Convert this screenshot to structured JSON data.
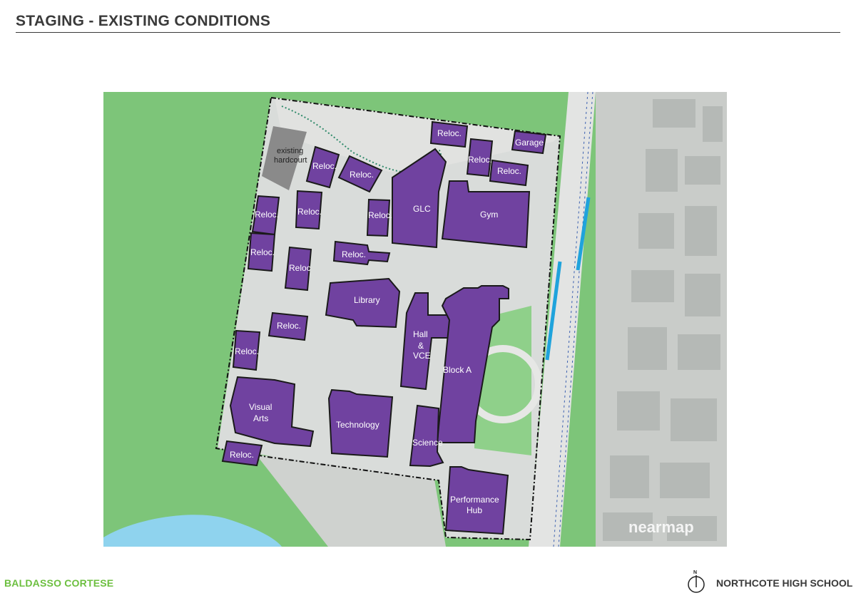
{
  "header": {
    "title": "STAGING - EXISTING CONDITIONS"
  },
  "map": {
    "watermark": "nearmap",
    "hardcourt_label": [
      "existing",
      "hardcourt"
    ],
    "buildings": {
      "reloc_top_right": "Reloc.",
      "garage": "Garage",
      "reloc_hc_1": "Reloc.",
      "reloc_hc_2": "Reloc.",
      "reloc_right_1": "Reloc.",
      "reloc_right_2": "Reloc.",
      "glc": "GLC",
      "gym": "Gym",
      "reloc_w1": "Reloc.",
      "reloc_w2": "Reloc.",
      "reloc_mid": "Reloc.",
      "reloc_w3": "Reloc.",
      "reloc_w4": "Reloc",
      "reloc_center": "Reloc.",
      "library": "Library",
      "reloc_sw1": "Reloc.",
      "reloc_sw2": "Reloc.",
      "hall": [
        "Hall",
        "&",
        "VCE"
      ],
      "block_a": "Block A",
      "visual_arts": [
        "Visual",
        "Arts"
      ],
      "technology": "Technology",
      "science": "Science",
      "reloc_bottom": "Reloc.",
      "performance_hub": [
        "Performance",
        "Hub"
      ]
    },
    "colors": {
      "building_fill": "#7042a0",
      "grass": "#7dc579",
      "grass_light": "#8fd08a",
      "paving": "#d9dcda",
      "water": "#8fd3ee",
      "bike_lane": "#1fa3dc",
      "hardcourt": "#8a8a8a"
    }
  },
  "footer": {
    "left": "BALDASSO CORTESE",
    "north_symbol": "N",
    "right": "NORTHCOTE HIGH SCHOOL"
  }
}
